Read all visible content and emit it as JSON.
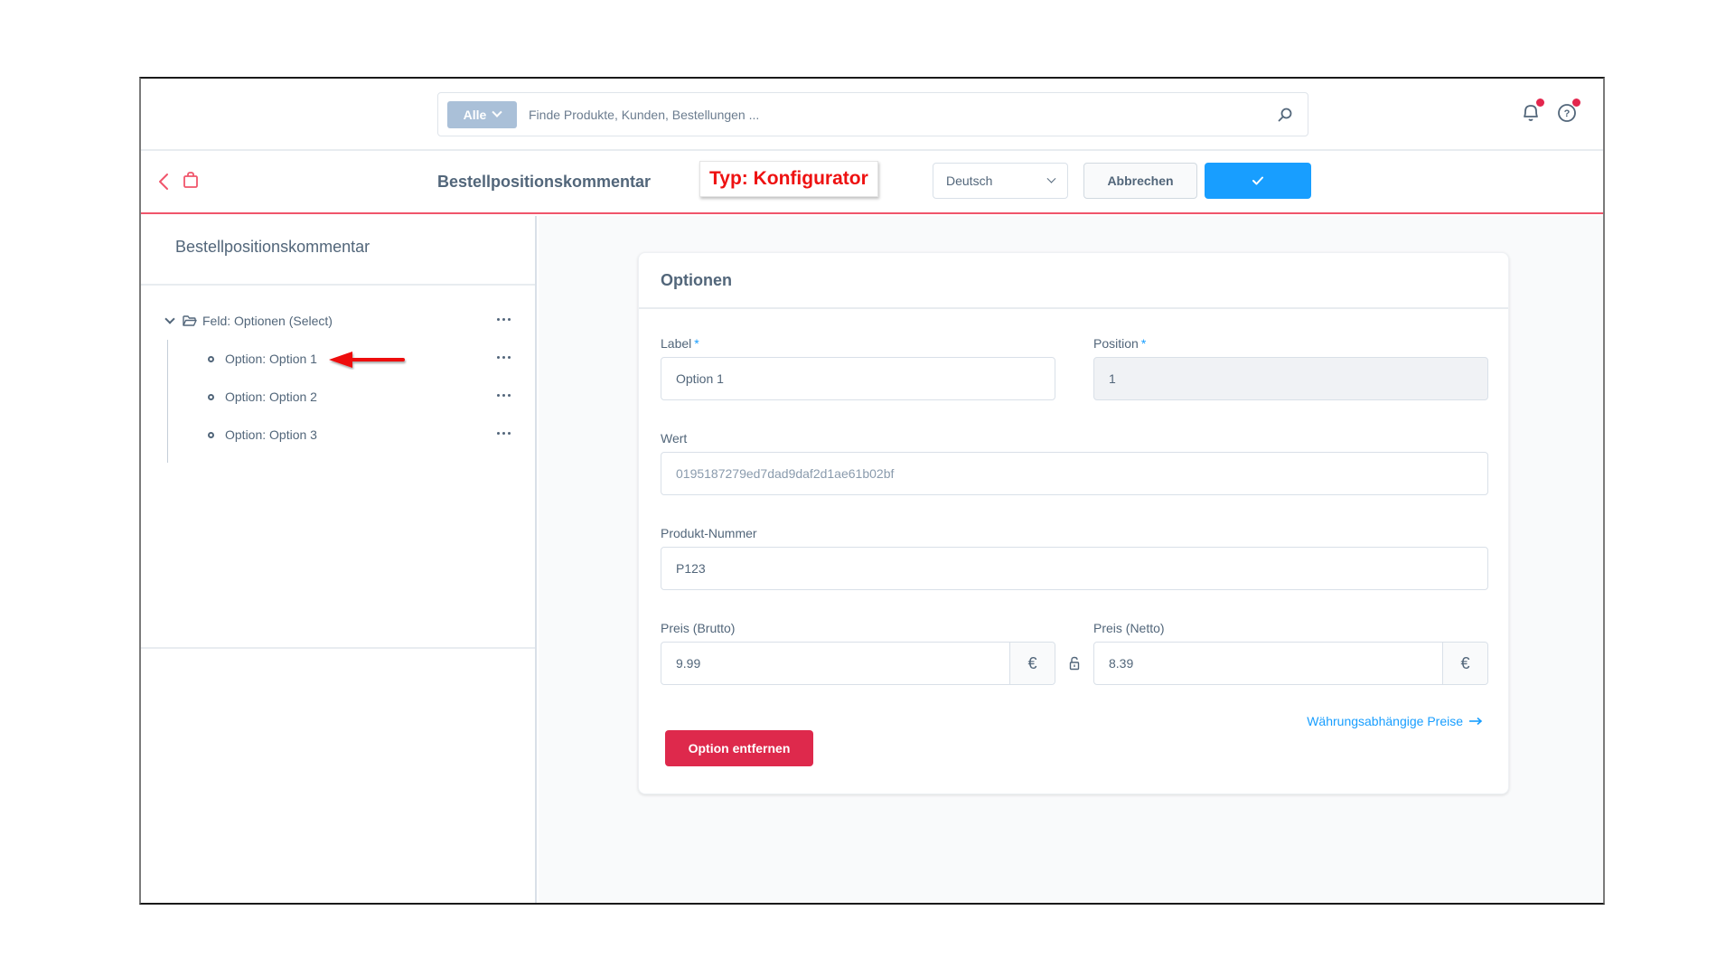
{
  "topbar": {
    "search_type": "Alle",
    "search_placeholder": "Finde Produkte, Kunden, Bestellungen ...",
    "icons": [
      "bell-icon",
      "help-icon"
    ]
  },
  "smartbar": {
    "title": "Bestellpositionskommentar",
    "type_annotation": "Typ: Konfigurator",
    "language": "Deutsch",
    "cancel_label": "Abbrechen",
    "save_icon": "checkmark-icon"
  },
  "sidebar": {
    "title": "Bestellpositionskommentar",
    "tree": {
      "parent": "Feld: Optionen (Select)",
      "children": [
        "Option: Option 1",
        "Option: Option 2",
        "Option: Option 3"
      ]
    }
  },
  "card": {
    "title": "Optionen",
    "fields": {
      "label": {
        "label": "Label",
        "required": "*",
        "value": "Option 1"
      },
      "position": {
        "label": "Position",
        "required": "*",
        "value": "1"
      },
      "wert": {
        "label": "Wert",
        "placeholder": "0195187279ed7dad9daf2d1ae61b02bf"
      },
      "produkt_nummer": {
        "label": "Produkt-Nummer",
        "value": "P123"
      },
      "preis_brutto": {
        "label": "Preis (Brutto)",
        "value": "9.99",
        "currency": "€"
      },
      "preis_netto": {
        "label": "Preis (Netto)",
        "value": "8.39",
        "currency": "€"
      }
    },
    "currency_link": "Währungsabhängige Preise",
    "remove_label": "Option entfernen"
  },
  "colors": {
    "primary": "#189eff",
    "danger": "#de294c",
    "annotation": "#ee1111",
    "text": "#52667a"
  }
}
